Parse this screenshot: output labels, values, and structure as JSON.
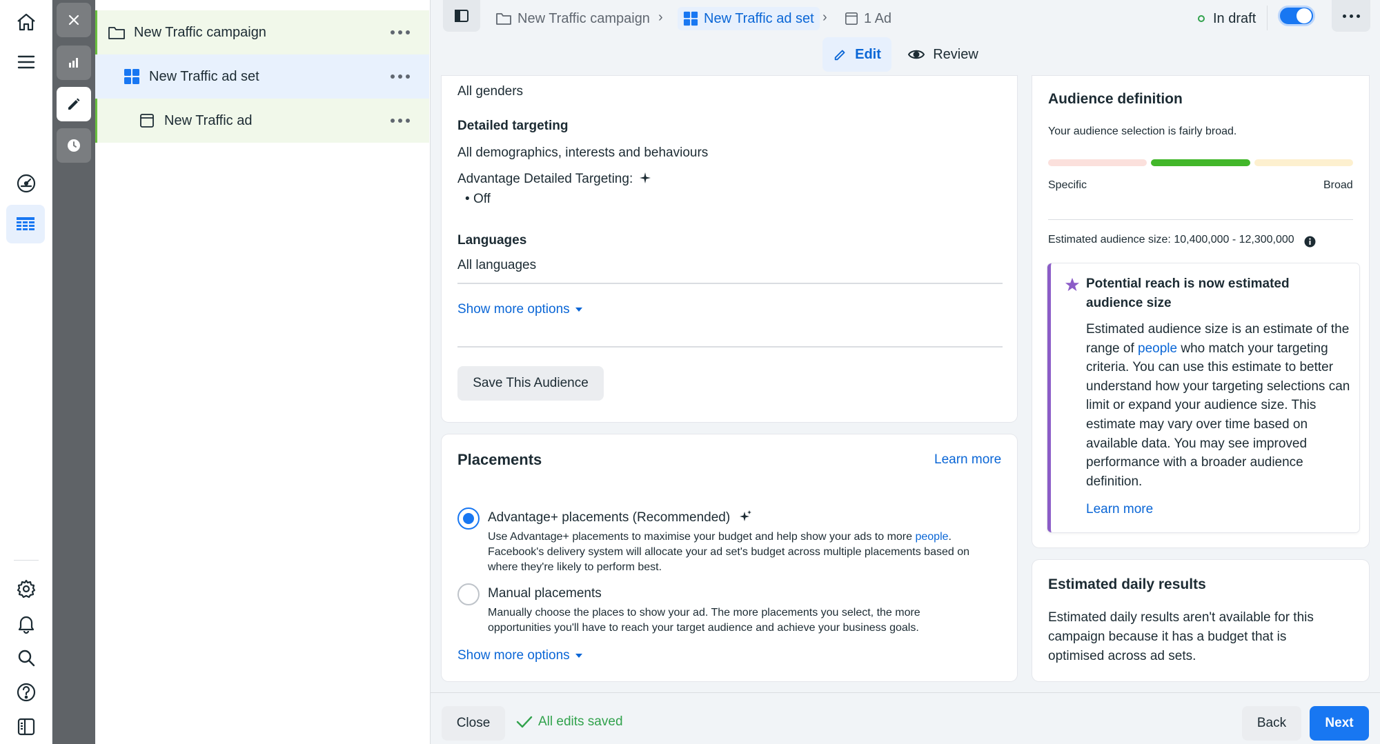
{
  "tree": {
    "campaign": "New Traffic campaign",
    "ad_set": "New Traffic ad set",
    "ad": "New Traffic ad"
  },
  "header": {
    "crumb_campaign": "New Traffic campaign",
    "crumb_ad_set": "New Traffic ad set",
    "crumb_ad": "1 Ad",
    "status": "In draft",
    "tab_edit": "Edit",
    "tab_review": "Review"
  },
  "audience_card": {
    "genders": "All genders",
    "detailed_targeting_label": "Detailed targeting",
    "detailed_targeting_value": "All demographics, interests and behaviours",
    "advantage_label": "Advantage Detailed Targeting:",
    "advantage_value": "Off",
    "languages_label": "Languages",
    "languages_value": "All languages",
    "show_more": "Show more options",
    "save_audience": "Save This Audience"
  },
  "placements_card": {
    "title": "Placements",
    "learn_more": "Learn more",
    "advantage_title": "Advantage+ placements (Recommended)",
    "advantage_desc_1": "Use Advantage+ placements to maximise your budget and help show your ads to more ",
    "advantage_desc_link": "people",
    "advantage_desc_2": "Facebook's delivery system will allocate your ad set's budget across multiple placements based on where they're likely to perform best.",
    "manual_title": "Manual placements",
    "manual_desc": "Manually choose the places to show your ad. The more placements you select, the more opportunities you'll have to reach your target audience and achieve your business goals.",
    "show_more": "Show more options",
    "selected": "advantage"
  },
  "audience_definition": {
    "title": "Audience definition",
    "subtitle": "Your audience selection is fairly broad.",
    "specific": "Specific",
    "broad": "Broad",
    "estimate_label": "Estimated audience size: 10,400,000 - 12,300,000",
    "meter_level": "middle",
    "notice_title": "Potential reach is now estimated audience size",
    "notice_body_1": "Estimated audience size is an estimate of the range of ",
    "notice_body_link": "people",
    "notice_body_2": " who match your targeting criteria. You can use this estimate to better understand how your targeting selections can limit or expand your audience size. This estimate may vary over time based on available data. You may see improved performance with a broader audience definition.",
    "notice_learn_more": "Learn more"
  },
  "daily_results": {
    "title": "Estimated daily results",
    "body": "Estimated daily results aren't available for this campaign because it has a budget that is optimised across ad sets."
  },
  "footer": {
    "close": "Close",
    "saved": "All edits saved",
    "back": "Back",
    "next": "Next"
  },
  "colors": {
    "accent": "#1877f2",
    "link": "#0a66d6",
    "success": "#31a24c",
    "notice_bar": "#8b5cc7"
  }
}
